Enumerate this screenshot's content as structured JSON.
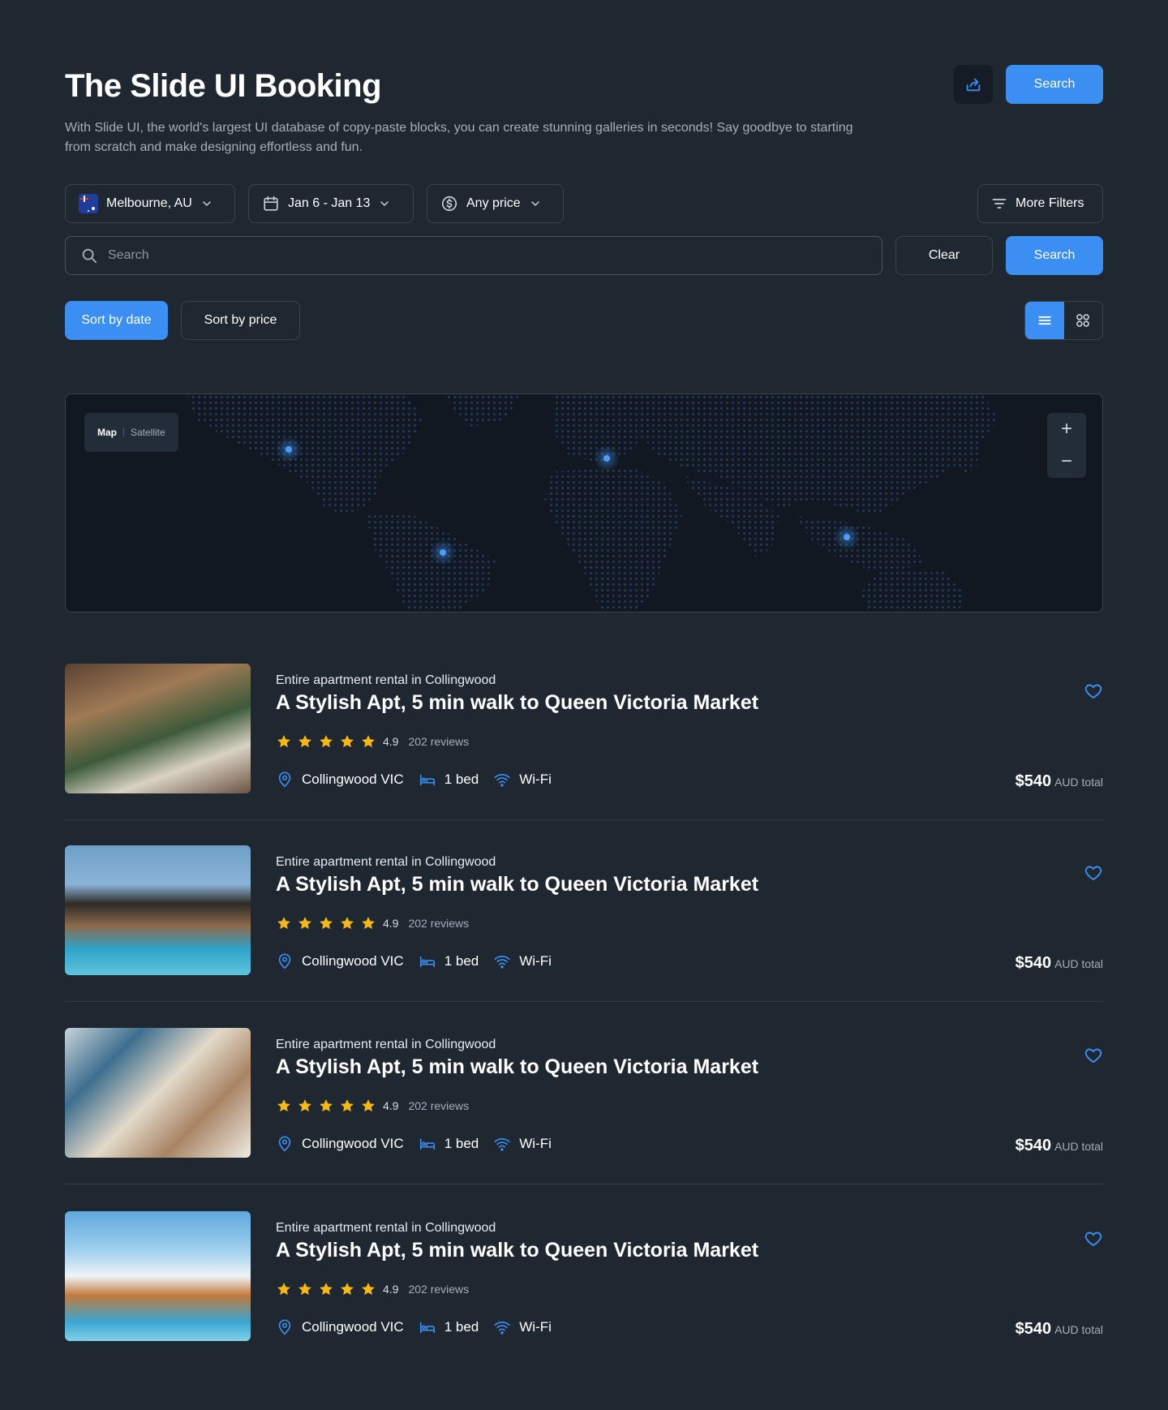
{
  "header": {
    "title": "The Slide UI Booking",
    "subtitle": "With Slide UI, the world's largest UI database of copy-paste blocks, you can create stunning galleries in seconds! Say goodbye to starting from scratch and make designing effortless and fun.",
    "search_label": "Search",
    "share_icon": "share-icon"
  },
  "filters": {
    "location": "Melbourne, AU",
    "dates": "Jan 6 - Jan 13",
    "price": "Any price",
    "more_filters": "More Filters"
  },
  "search": {
    "placeholder": "Search",
    "clear_label": "Clear",
    "search_label": "Search"
  },
  "sort": {
    "by_date": "Sort by date",
    "by_price": "Sort by price",
    "active": "by_date",
    "view_mode": "list"
  },
  "map": {
    "type_map": "Map",
    "type_satellite": "Satellite",
    "active_type": "Map",
    "zoom_in": "+",
    "zoom_out": "−"
  },
  "colors": {
    "accent": "#3b8ff3",
    "background": "#1f2731",
    "star": "#f5b814"
  },
  "listings": [
    {
      "kind": "Entire apartment rental in Collingwood",
      "name": "A Stylish Apt, 5 min walk to Queen Victoria Market",
      "rating": "4.9",
      "stars": 5,
      "reviews": "202 reviews",
      "location": "Collingwood VIC",
      "beds": "1 bed",
      "wifi": "Wi-Fi",
      "price": "$540",
      "price_suffix": "AUD total"
    },
    {
      "kind": "Entire apartment rental in Collingwood",
      "name": "A Stylish Apt, 5 min walk to Queen Victoria Market",
      "rating": "4.9",
      "stars": 5,
      "reviews": "202 reviews",
      "location": "Collingwood VIC",
      "beds": "1 bed",
      "wifi": "Wi-Fi",
      "price": "$540",
      "price_suffix": "AUD total"
    },
    {
      "kind": "Entire apartment rental in Collingwood",
      "name": "A Stylish Apt, 5 min walk to Queen Victoria Market",
      "rating": "4.9",
      "stars": 5,
      "reviews": "202 reviews",
      "location": "Collingwood VIC",
      "beds": "1 bed",
      "wifi": "Wi-Fi",
      "price": "$540",
      "price_suffix": "AUD total"
    },
    {
      "kind": "Entire apartment rental in Collingwood",
      "name": "A Stylish Apt, 5 min walk to Queen Victoria Market",
      "rating": "4.9",
      "stars": 5,
      "reviews": "202 reviews",
      "location": "Collingwood VIC",
      "beds": "1 bed",
      "wifi": "Wi-Fi",
      "price": "$540",
      "price_suffix": "AUD total"
    }
  ]
}
